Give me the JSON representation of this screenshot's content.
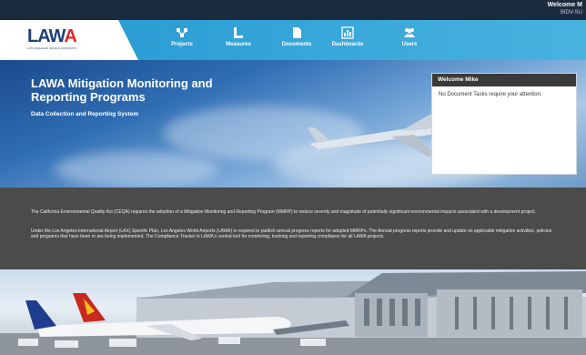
{
  "header": {
    "welcome_line1": "Welcome M",
    "welcome_line2": "BIDV-SU"
  },
  "logo": {
    "word_main": "LAW",
    "word_end": "A",
    "sub": "LOS ANGELES WORLD AIRPORTS"
  },
  "nav": {
    "items": [
      {
        "label": "Projects",
        "icon": "projects-icon"
      },
      {
        "label": "Measures",
        "icon": "measures-icon"
      },
      {
        "label": "Documents",
        "icon": "documents-icon"
      },
      {
        "label": "Dashboards",
        "icon": "dashboards-icon"
      },
      {
        "label": "Users",
        "icon": "users-icon"
      }
    ]
  },
  "hero": {
    "title": "LAWA Mitigation Monitoring and Reporting Programs",
    "subtitle": "Data Collection and Reporting System"
  },
  "welcome_card": {
    "heading": "Welcome Mike",
    "message": "No Document Tasks require your attention."
  },
  "info": {
    "paragraph1": "The California Environmental Quality Act (CEQA) requires the adoption of a Mitigation Monitoring and Reporting Program (MMRP) to reduce severity and magnitude of potentially significant environmental impacts associated with a development project.",
    "paragraph2": "Under the Los Angeles International Airport (LAX) Specific Plan, Los Angeles World Airports (LAWA) is required to publish annual progress reports for adopted MMRPs. The Annual progress reports provide and update on applicable mitigation activities, policies and programs that have been or are being implemented. The Compliance Tracker is LAWA's central tool for monitoring, tracking and reporting compliance for all LAWA projects."
  },
  "colors": {
    "topbar": "#1b2a3d",
    "nav_blue": "#2c9ed4",
    "logo_blue": "#1d3f7a",
    "logo_red": "#e0262b",
    "info_band": "#4b4b4b"
  }
}
